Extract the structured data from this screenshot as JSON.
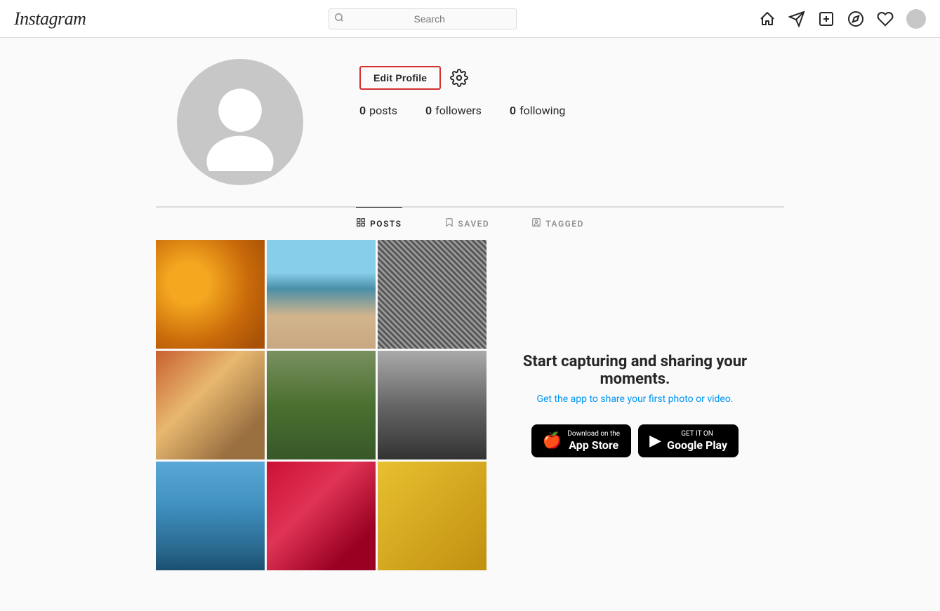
{
  "header": {
    "logo": "Instagram",
    "search": {
      "placeholder": "Search"
    },
    "icons": {
      "home": "⌂",
      "send": "▷",
      "add": "⊕",
      "explore": "◎",
      "heart": "♡"
    }
  },
  "profile": {
    "username": "",
    "edit_profile_label": "Edit Profile",
    "stats": {
      "posts": {
        "count": "0",
        "label": "posts"
      },
      "followers": {
        "count": "0",
        "label": "followers"
      },
      "following": {
        "count": "0",
        "label": "following"
      }
    }
  },
  "tabs": [
    {
      "id": "posts",
      "label": "POSTS",
      "active": true
    },
    {
      "id": "saved",
      "label": "SAVED",
      "active": false
    },
    {
      "id": "tagged",
      "label": "TAGGED",
      "active": false
    }
  ],
  "promo": {
    "title": "Start capturing and sharing your moments.",
    "subtitle": "Get the app to share your first photo or video.",
    "appstore_label_small": "Download on the",
    "appstore_label_large": "App Store",
    "googleplay_label_small": "GET IT ON",
    "googleplay_label_large": "Google Play"
  }
}
